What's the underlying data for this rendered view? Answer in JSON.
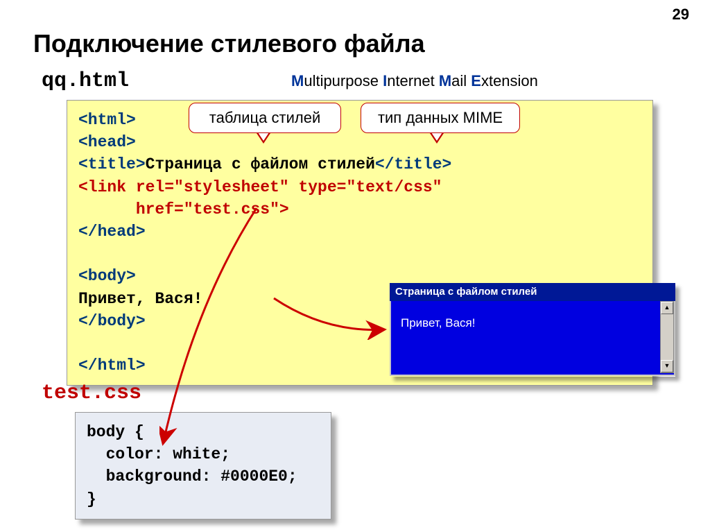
{
  "page_number": "29",
  "title": "Подключение стилевого файла",
  "filename_html": "qq.html",
  "filename_css": "test.css",
  "mime": {
    "m1": "M",
    "t1": "ultipurpose ",
    "m2": "I",
    "t2": "nternet ",
    "m3": "M",
    "t3": "ail ",
    "m4": "E",
    "t4": "xtension"
  },
  "callout1": "таблица стилей",
  "callout2": "тип данных MIME",
  "html_code": {
    "l1a": "<html>",
    "l2a": "<head>",
    "l3a": "<title>",
    "l3b": "Страница с файлом стилей",
    "l3c": "</title>",
    "l4a": "<link rel=\"stylesheet\" type=\"text/css\"",
    "l5a": "      href=\"",
    "l5b": "test.css",
    "l5c": "\">",
    "l6a": "</head>",
    "blank1": "",
    "l7a": "<body>",
    "l8a": "Привет, Вася!",
    "l9a": "</body>",
    "blank2": "",
    "l10a": "</html>"
  },
  "css_code": {
    "l1": "body {",
    "l2": "  color: white;",
    "l3": "  background: #0000E0;",
    "l4": "}"
  },
  "browser": {
    "title": "Страница с файлом стилей",
    "content": "Привет, Вася!"
  }
}
